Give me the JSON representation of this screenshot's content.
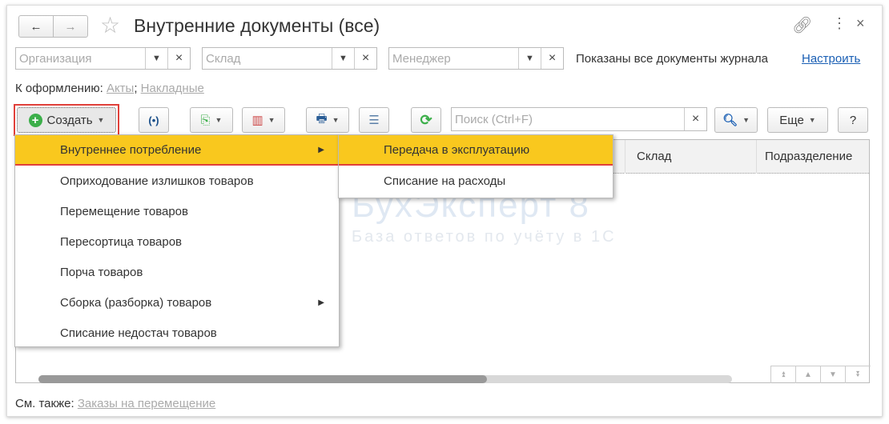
{
  "window": {
    "title": "Внутренние документы (все)",
    "back_icon": "arrow-left",
    "forward_icon": "arrow-right"
  },
  "filters": {
    "organization_placeholder": "Организация",
    "warehouse_placeholder": "Склад",
    "manager_placeholder": "Менеджер",
    "clear": "×",
    "status_text": "Показаны все документы журнала",
    "configure_link": "Настроить"
  },
  "to_process": {
    "label": "К оформлению:",
    "links": [
      "Акты",
      "Накладные"
    ],
    "sep": ";"
  },
  "toolbar": {
    "create_label": "Создать",
    "search_placeholder": "Поиск (Ctrl+F)",
    "more_label": "Еще",
    "help_label": "?"
  },
  "table": {
    "columns": [
      "Склад",
      "Подразделение"
    ]
  },
  "create_menu": {
    "items": [
      {
        "label": "Внутреннее потребление",
        "submenu": true
      },
      {
        "label": "Оприходование излишков товаров"
      },
      {
        "label": "Перемещение товаров"
      },
      {
        "label": "Пересортица товаров"
      },
      {
        "label": "Порча товаров"
      },
      {
        "label": "Сборка (разборка) товаров",
        "submenu": true
      },
      {
        "label": "Списание недостач товаров"
      }
    ]
  },
  "submenu": {
    "items": [
      "Передача в эксплуатацию",
      "Списание на расходы"
    ]
  },
  "footer": {
    "see_also": "См. также:",
    "link": "Заказы на перемещение"
  },
  "watermark": {
    "brand": "БухЭксперт",
    "tagline": "База ответов по учёту в 1С"
  },
  "colors": {
    "highlight": "#f9c81e",
    "accent_red": "#e0403a",
    "link": "#1a5fb4"
  }
}
